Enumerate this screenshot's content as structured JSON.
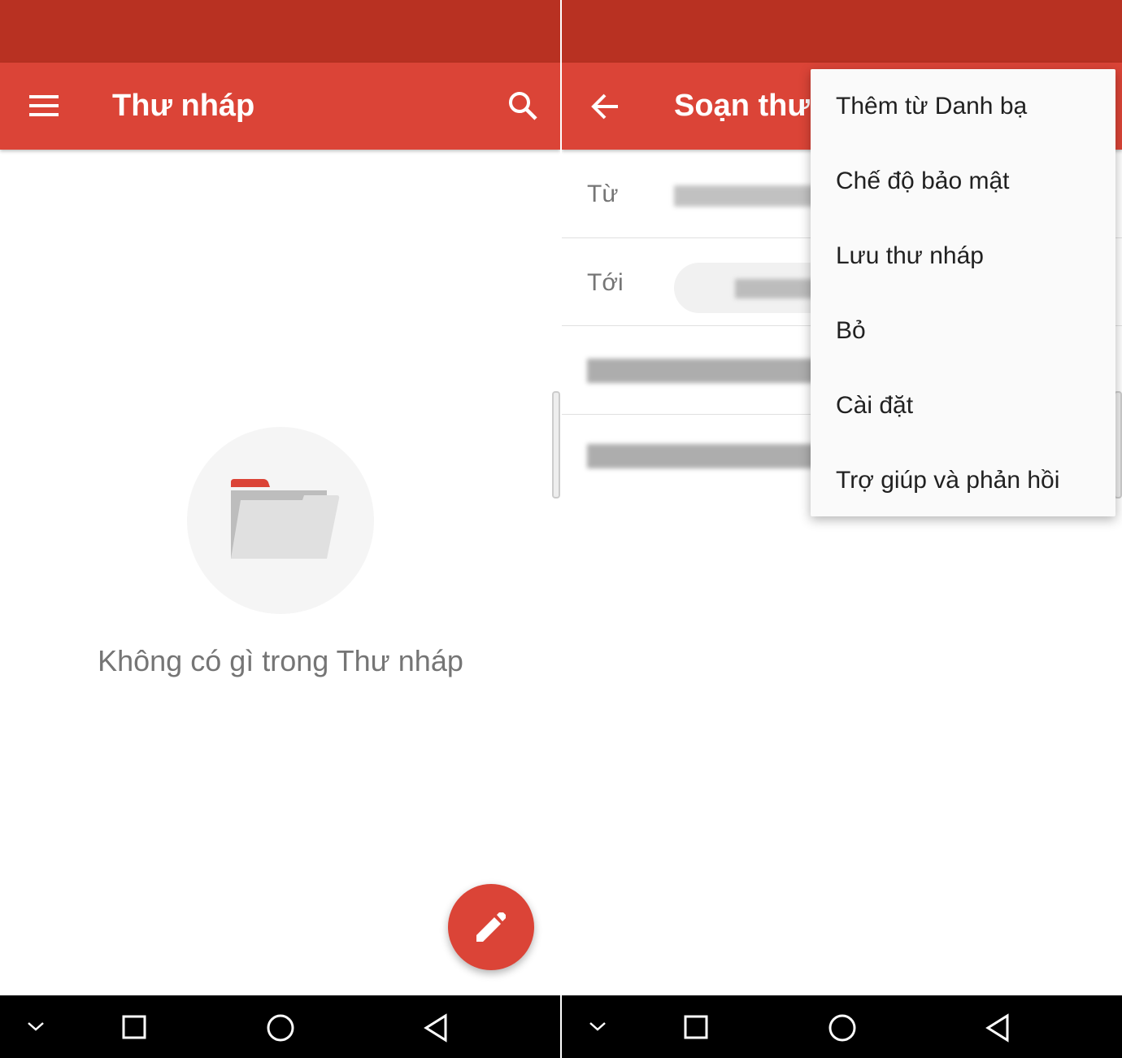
{
  "left": {
    "toolbar": {
      "title": "Thư nháp",
      "menu_icon": "hamburger-menu-icon",
      "search_icon": "search-icon"
    },
    "empty_state": {
      "icon": "folder-icon",
      "message": "Không có gì trong Thư nháp"
    },
    "fab": {
      "icon": "pencil-icon"
    }
  },
  "right": {
    "toolbar": {
      "title": "Soạn thư",
      "back_icon": "arrow-left-icon"
    },
    "form": {
      "from_label": "Từ",
      "to_label": "Tới"
    },
    "menu": {
      "items": [
        {
          "label": "Thêm từ Danh bạ"
        },
        {
          "label": "Chế độ bảo mật"
        },
        {
          "label": "Lưu thư nháp"
        },
        {
          "label": "Bỏ"
        },
        {
          "label": "Cài đặt"
        },
        {
          "label": "Trợ giúp và phản hồi"
        }
      ]
    }
  },
  "navbar": {
    "icons": [
      "chevron-down-icon",
      "recents-square-icon",
      "home-circle-icon",
      "back-triangle-icon"
    ]
  },
  "colors": {
    "status_bar": "#b83122",
    "toolbar": "#db4437",
    "accent": "#db4437"
  }
}
